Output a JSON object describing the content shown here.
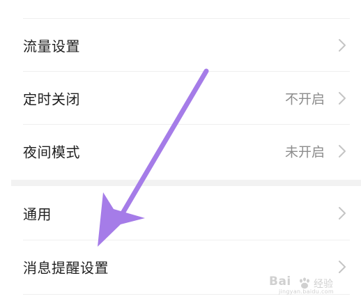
{
  "settings": {
    "items": [
      {
        "label": "流量设置",
        "value": ""
      },
      {
        "label": "定时关闭",
        "value": "不开启"
      },
      {
        "label": "夜间模式",
        "value": "未开启"
      },
      {
        "label": "通用",
        "value": ""
      },
      {
        "label": "消息提醒设置",
        "value": ""
      }
    ]
  },
  "annotation": {
    "arrow_color": "#a57ce8"
  },
  "watermark": {
    "brand": "Bai",
    "suffix": "经验",
    "url": "jingyan.baidu.com"
  }
}
